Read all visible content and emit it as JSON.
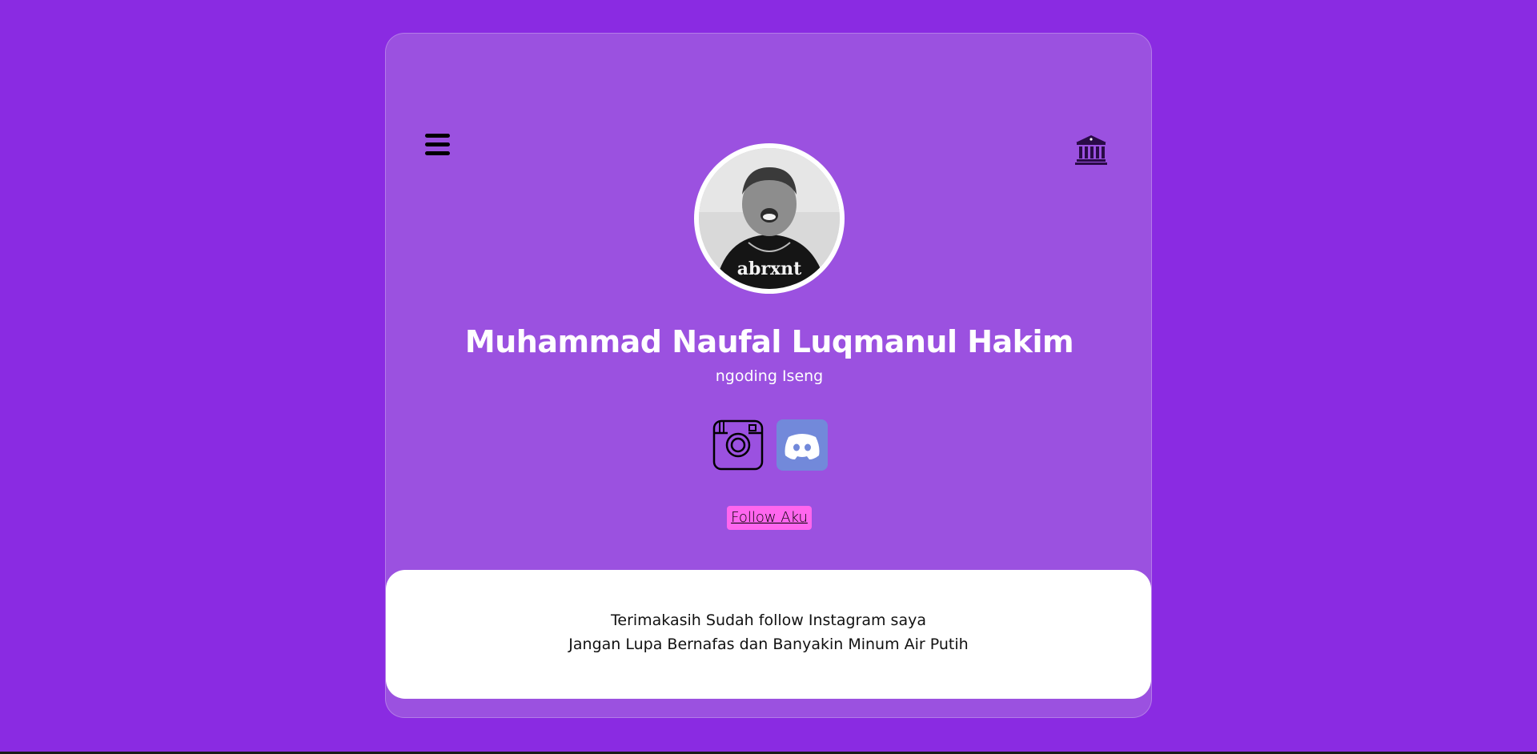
{
  "profile": {
    "name": "Muhammad Naufal Luqmanul Hakim",
    "subtitle": "ngoding Iseng",
    "avatar_shirt_text": "abrxnt"
  },
  "socials": {
    "instagram_icon": "instagram-icon",
    "discord_icon": "discord-icon"
  },
  "follow_label": "Follow Aku",
  "message": {
    "line1": "Terimakasih Sudah follow Instagram saya",
    "line2": "Jangan Lupa Bernafas dan Banyakin Minum Air Putih"
  },
  "colors": {
    "background": "#8a2be2",
    "card": "#9b51e0",
    "follow_button": "#ff66ee",
    "discord": "#7289da"
  }
}
